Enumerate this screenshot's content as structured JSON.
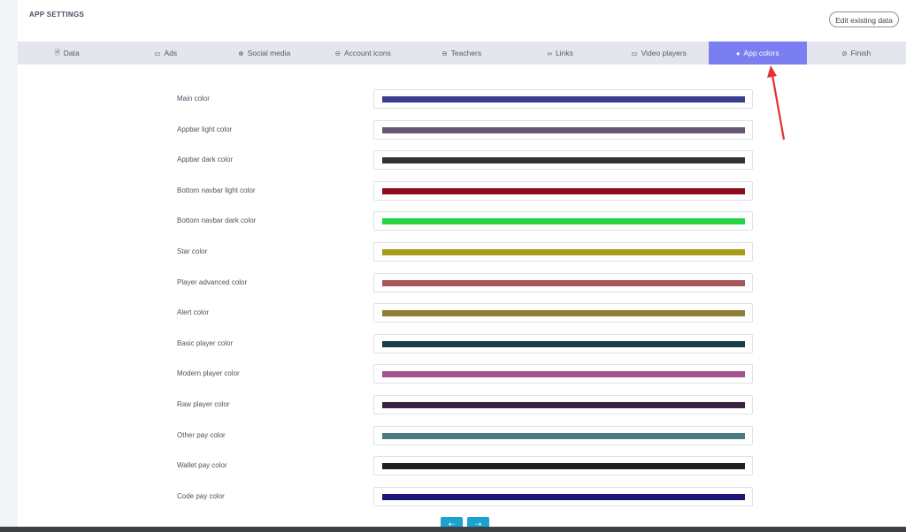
{
  "page": {
    "title": "APP SETTINGS",
    "edit_button": "Edit existing data"
  },
  "tabs": [
    {
      "label": "Data",
      "icon": "database-icon",
      "glyph": "🗎",
      "active": false
    },
    {
      "label": "Ads",
      "icon": "ads-icon",
      "glyph": "▭",
      "active": false
    },
    {
      "label": "Social media",
      "icon": "globe-icon",
      "glyph": "⊕",
      "active": false
    },
    {
      "label": "Account icons",
      "icon": "account-icon",
      "glyph": "⊖",
      "active": false
    },
    {
      "label": "Teachers",
      "icon": "teacher-icon",
      "glyph": "⊖",
      "active": false
    },
    {
      "label": "Links",
      "icon": "link-icon",
      "glyph": "∞",
      "active": false
    },
    {
      "label": "Video players",
      "icon": "video-icon",
      "glyph": "▭",
      "active": false
    },
    {
      "label": "App colors",
      "icon": "palette-icon",
      "glyph": "●",
      "active": true
    },
    {
      "label": "Finish",
      "icon": "check-circle-icon",
      "glyph": "⊘",
      "active": false
    }
  ],
  "colors": [
    {
      "label": "Main color",
      "value": "#3b3d8e"
    },
    {
      "label": "Appbar light color",
      "value": "#675777"
    },
    {
      "label": "Appbar dark color",
      "value": "#333333"
    },
    {
      "label": "Bottom navbar light color",
      "value": "#8e0a1c"
    },
    {
      "label": "Bottom navbar dark color",
      "value": "#27d544"
    },
    {
      "label": "Star color",
      "value": "#a99d18"
    },
    {
      "label": "Player advanced color",
      "value": "#a75658"
    },
    {
      "label": "Alert color",
      "value": "#8d8035"
    },
    {
      "label": "Basic player color",
      "value": "#173d47"
    },
    {
      "label": "Modern player color",
      "value": "#a5518f"
    },
    {
      "label": "Raw player color",
      "value": "#3a2241"
    },
    {
      "label": "Other pay color",
      "value": "#4b7b82"
    },
    {
      "label": "Wallet pay color",
      "value": "#1f1f1f"
    },
    {
      "label": "Code pay color",
      "value": "#1e1676"
    }
  ],
  "pager": {
    "prev": "⇠",
    "next": "⇢"
  },
  "annotation": {
    "arrow_color": "#e53030"
  }
}
